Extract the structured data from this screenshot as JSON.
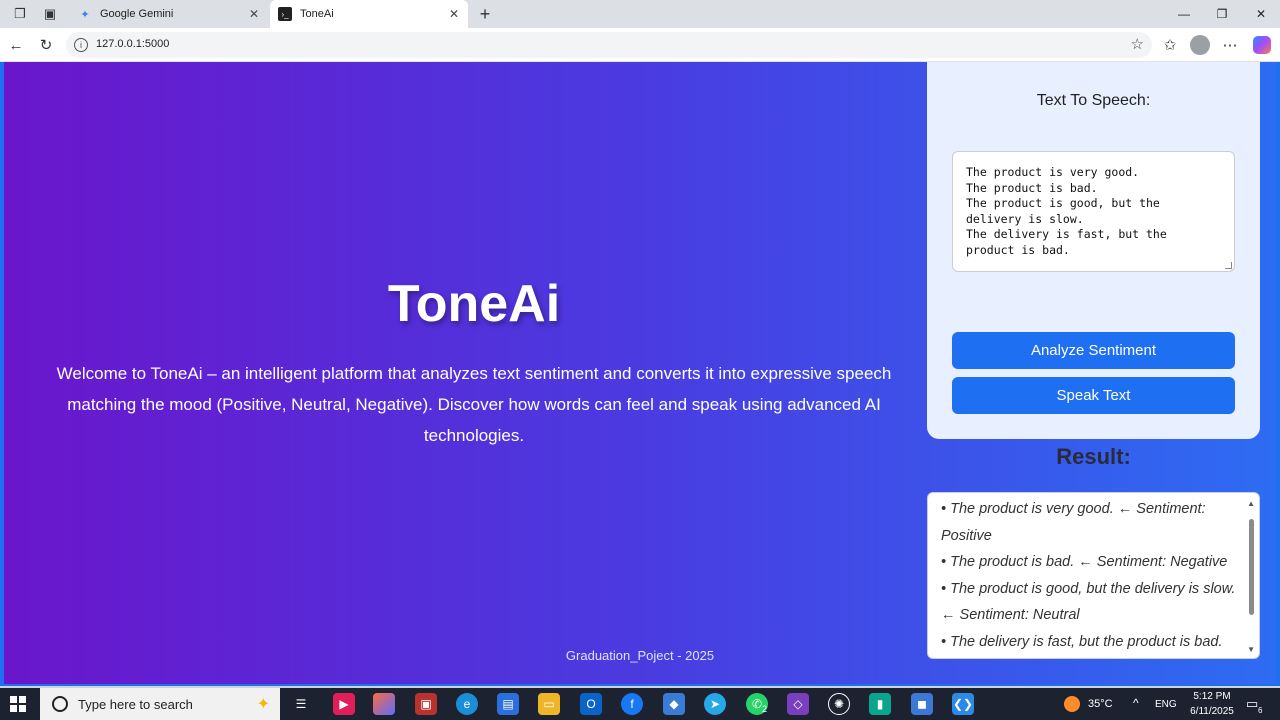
{
  "browser": {
    "tabs": [
      {
        "title": "Google Gemini",
        "active": false,
        "icon": "gemini-icon"
      },
      {
        "title": "ToneAi",
        "active": true,
        "icon": "terminal-icon"
      }
    ],
    "url": "127.0.0.1:5000"
  },
  "page": {
    "hero_title": "ToneAi",
    "hero_description": "Welcome to ToneAi – an intelligent platform that analyzes text sentiment and converts it into expressive speech matching the mood (Positive, Neutral, Negative). Discover how words can feel and speak using advanced AI technologies.",
    "footer": "Graduation_Poject - 2025",
    "panel": {
      "title": "Text To Speech:",
      "input_text": "The product is very good.\nThe product is bad.\nThe product is good, but the delivery is slow.\nThe delivery is fast, but the product is bad.",
      "analyze_button": "Analyze Sentiment",
      "speak_button": "Speak Text"
    },
    "result": {
      "title": "Result:",
      "items": [
        "• The product is very good. ← Sentiment: Positive",
        "• The product is bad. ← Sentiment: Negative",
        "• The product is good, but the delivery is slow. ← Sentiment: Neutral",
        "• The delivery is fast, but the product is bad."
      ]
    }
  },
  "taskbar": {
    "search_placeholder": "Type here to search",
    "temperature": "35°C",
    "language": "ENG",
    "time": "5:12 PM",
    "date": "6/11/2025",
    "whatsapp_badge": "2",
    "notification_count": "6"
  },
  "colors": {
    "gradient_start": "#6a16cc",
    "gradient_end": "#2d6cf3",
    "button_blue": "#1f6ff2",
    "panel_bg": "#e8efff"
  }
}
